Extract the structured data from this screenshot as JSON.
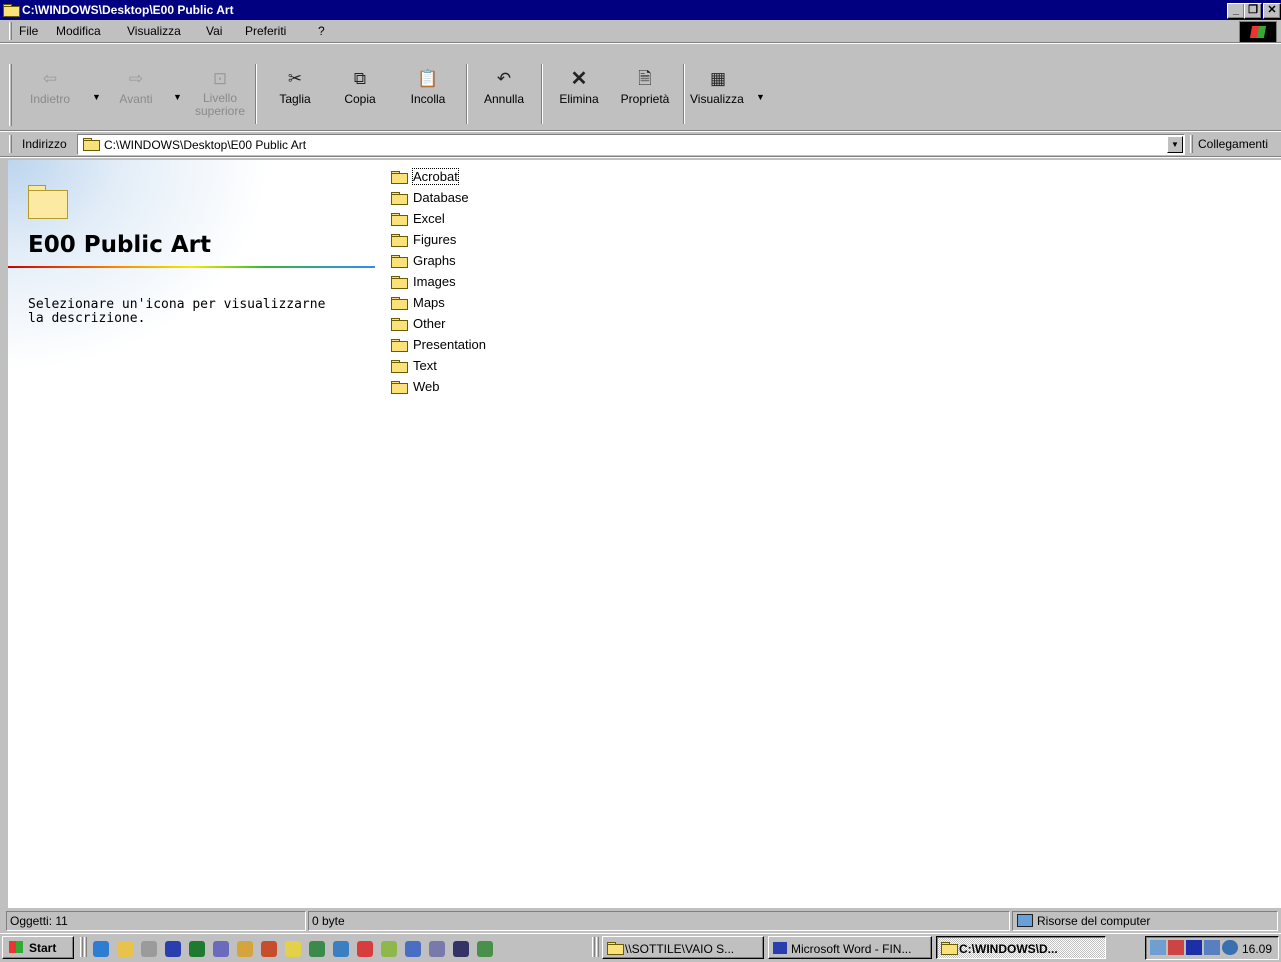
{
  "window": {
    "title": "C:\\WINDOWS\\Desktop\\E00 Public Art",
    "minimize": "_",
    "maximize": "❐",
    "close": "✕"
  },
  "menu": [
    {
      "label": "File"
    },
    {
      "label": "Modifica"
    },
    {
      "label": "Visualizza"
    },
    {
      "label": "Vai"
    },
    {
      "label": "Preferiti"
    },
    {
      "label": "?"
    }
  ],
  "toolbar": {
    "back": {
      "label": "Indietro",
      "icon": "back-arrow-icon"
    },
    "forward": {
      "label": "Avanti",
      "icon": "forward-arrow-icon"
    },
    "up": {
      "label1": "Livello",
      "label2": "superiore",
      "icon": "up-folder-icon"
    },
    "cut": {
      "label": "Taglia",
      "icon": "scissors-icon"
    },
    "copy": {
      "label": "Copia",
      "icon": "copy-icon"
    },
    "paste": {
      "label": "Incolla",
      "icon": "paste-icon"
    },
    "undo": {
      "label": "Annulla",
      "icon": "undo-icon"
    },
    "delete": {
      "label": "Elimina",
      "icon": "delete-x-icon"
    },
    "properties": {
      "label": "Proprietà",
      "icon": "properties-icon"
    },
    "views": {
      "label": "Visualizza",
      "icon": "views-icon"
    }
  },
  "address": {
    "label": "Indirizzo",
    "value": "C:\\WINDOWS\\Desktop\\E00 Public Art",
    "links": "Collegamenti"
  },
  "infopane": {
    "folder_name": "E00 Public Art",
    "hint": "Selezionare un'icona per visualizzarne la descrizione."
  },
  "items": [
    {
      "name": "Acrobat"
    },
    {
      "name": "Database"
    },
    {
      "name": "Excel"
    },
    {
      "name": "Figures"
    },
    {
      "name": "Graphs"
    },
    {
      "name": "Images"
    },
    {
      "name": "Maps"
    },
    {
      "name": "Other"
    },
    {
      "name": "Presentation"
    },
    {
      "name": "Text"
    },
    {
      "name": "Web"
    }
  ],
  "status": {
    "objects": "Oggetti: 11",
    "size": "0 byte",
    "zone": "Risorse del computer"
  },
  "taskbar": {
    "start": "Start",
    "tasks": [
      {
        "label": "\\\\SOTTILE\\VAIO S..."
      },
      {
        "label": "Microsoft Word - FIN..."
      },
      {
        "label": "C:\\WINDOWS\\D..."
      }
    ],
    "clock": "16.09"
  },
  "colors": {
    "titlebar": "#000080",
    "folder": "#fbe17a",
    "face": "#c0c0c0"
  }
}
